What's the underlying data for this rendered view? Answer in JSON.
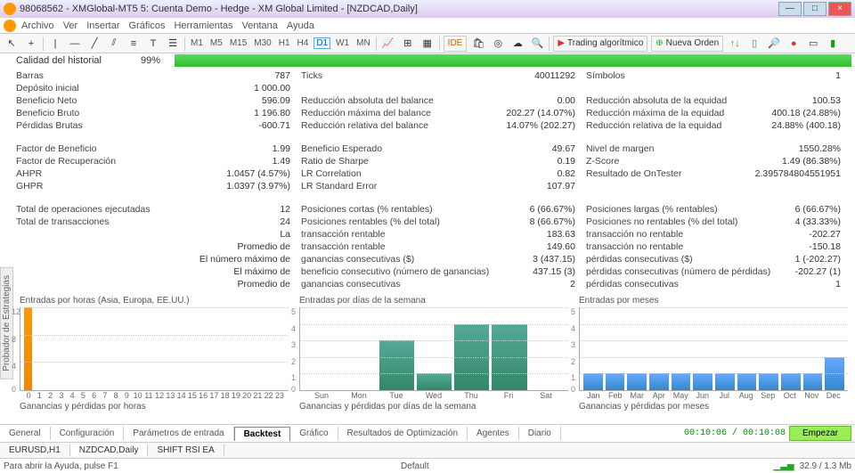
{
  "titlebar": "98068562 - XMGlobal-MT5 5: Cuenta Demo - Hedge - XM Global Limited - [NZDCAD,Daily]",
  "menu": [
    "Archivo",
    "Ver",
    "Insertar",
    "Gráficos",
    "Herramientas",
    "Ventana",
    "Ayuda"
  ],
  "timeframes": [
    "M1",
    "M5",
    "M15",
    "M30",
    "H1",
    "H4",
    "D1",
    "W1",
    "MN"
  ],
  "tf_selected": "D1",
  "ide": "IDE",
  "algo": "Trading algorítmico",
  "new_order": "Nueva Orden",
  "quality": {
    "label": "Calidad del historial",
    "pct": "99%"
  },
  "r1": [
    [
      "Barras",
      "787",
      "Ticks",
      "40011292",
      "Símbolos",
      "1"
    ],
    [
      "Depósito inicial",
      "1 000.00",
      "",
      "",
      "",
      ""
    ],
    [
      "Beneficio Neto",
      "596.09",
      "Reducción absoluta del balance",
      "0.00",
      "Reducción absoluta de la equidad",
      "100.53"
    ],
    [
      "Beneficio Bruto",
      "1 196.80",
      "Reducción máxima del balance",
      "202.27 (14.07%)",
      "Reducción máxima de la equidad",
      "400.18 (24.88%)"
    ],
    [
      "Pérdidas Brutas",
      "-600.71",
      "Reducción relativa del balance",
      "14.07% (202.27)",
      "Reducción relativa de la equidad",
      "24.88% (400.18)"
    ]
  ],
  "r2": [
    [
      "Factor de Beneficio",
      "1.99",
      "Beneficio Esperado",
      "49.67",
      "Nivel de margen",
      "1550.28%"
    ],
    [
      "Factor de Recuperación",
      "1.49",
      "Ratio de Sharpe",
      "0.19",
      "Z-Score",
      "1.49 (86.38%)"
    ],
    [
      "AHPR",
      "1.0457 (4.57%)",
      "LR Correlation",
      "0.82",
      "Resultado de OnTester",
      "2.395784804551951"
    ],
    [
      "GHPR",
      "1.0397 (3.97%)",
      "LR Standard Error",
      "107.97",
      "",
      ""
    ]
  ],
  "r3": [
    [
      "Total de operaciones ejecutadas",
      "12",
      "Posiciones cortas (% rentables)",
      "6 (66.67%)",
      "Posiciones largas (% rentables)",
      "6 (66.67%)"
    ],
    [
      "Total de transacciones",
      "24",
      "Posiciones rentables (% del total)",
      "8 (66.67%)",
      "Posiciones no rentables (% del total)",
      "4 (33.33%)"
    ],
    [
      "",
      "La",
      "transacción rentable",
      "183.63",
      "transacción no rentable",
      "-202.27"
    ],
    [
      "",
      "Promedio de",
      "transacción rentable",
      "149.60",
      "transacción no rentable",
      "-150.18"
    ],
    [
      "",
      "El número máximo de",
      "ganancias consecutivas ($)",
      "3 (437.15)",
      "pérdidas consecutivas ($)",
      "1 (-202.27)"
    ],
    [
      "",
      "El máximo de",
      "beneficio consecutivo (número de ganancias)",
      "437.15 (3)",
      "pérdidas consecutivas (número de pérdidas)",
      "-202.27 (1)"
    ],
    [
      "",
      "Promedio de",
      "ganancias consecutivas",
      "2",
      "pérdidas consecutivas",
      "1"
    ]
  ],
  "chart1": {
    "title": "Entradas por horas (Asia, Europa, EE.UU.)",
    "sub": "Ganancias y pérdidas por horas"
  },
  "chart2": {
    "title": "Entradas por días de la semana",
    "labels": [
      "Sun",
      "Mon",
      "Tue",
      "Wed",
      "Thu",
      "Fri",
      "Sat"
    ],
    "sub": "Ganancias y pérdidas por días de la semana"
  },
  "chart3": {
    "title": "Entradas por meses",
    "labels": [
      "Jan",
      "Feb",
      "Mar",
      "Apr",
      "May",
      "Jun",
      "Jul",
      "Aug",
      "Sep",
      "Oct",
      "Nov",
      "Dec"
    ],
    "sub": "Ganancias y pérdidas por meses"
  },
  "chart_data": [
    {
      "type": "bar",
      "title": "Entradas por horas (Asia, Europa, EE.UU.)",
      "categories": [
        "0",
        "1",
        "2",
        "3",
        "4",
        "5",
        "6",
        "7",
        "8",
        "9",
        "10",
        "11",
        "12",
        "13",
        "14",
        "15",
        "16",
        "17",
        "18",
        "19",
        "20",
        "21",
        "22",
        "23"
      ],
      "values": [
        12,
        0,
        0,
        0,
        0,
        0,
        0,
        0,
        0,
        0,
        0,
        0,
        0,
        0,
        0,
        0,
        0,
        0,
        0,
        0,
        0,
        0,
        0,
        0
      ],
      "ylim": [
        0,
        12
      ]
    },
    {
      "type": "bar",
      "title": "Entradas por días de la semana",
      "categories": [
        "Sun",
        "Mon",
        "Tue",
        "Wed",
        "Thu",
        "Fri",
        "Sat"
      ],
      "values": [
        0,
        0,
        3,
        1,
        4,
        4,
        0
      ],
      "ylim": [
        0,
        5
      ]
    },
    {
      "type": "bar",
      "title": "Entradas por meses",
      "categories": [
        "Jan",
        "Feb",
        "Mar",
        "Apr",
        "May",
        "Jun",
        "Jul",
        "Aug",
        "Sep",
        "Oct",
        "Nov",
        "Dec"
      ],
      "values": [
        1,
        1,
        1,
        1,
        1,
        1,
        1,
        1,
        1,
        1,
        1,
        2
      ],
      "ylim": [
        0,
        5
      ]
    }
  ],
  "bottom_tabs": [
    "General",
    "Configuración",
    "Parámetros de entrada",
    "Backtest",
    "Gráfico",
    "Resultados de Optimización",
    "Agentes",
    "Diario"
  ],
  "bt_sel": "Backtest",
  "timer": "00:10:06 / 00:10:08",
  "start": "Empezar",
  "doc_tabs": [
    "EURUSD,H1",
    "NZDCAD,Daily",
    "SHIFT RSI EA"
  ],
  "dt_sel": "NZDCAD,Daily",
  "status_left": "Para abrir la Ayuda, pulse F1",
  "status_center": "Default",
  "status_net": "32.9 / 1.3 Mb",
  "side_tab": "Probador de Estrategias"
}
